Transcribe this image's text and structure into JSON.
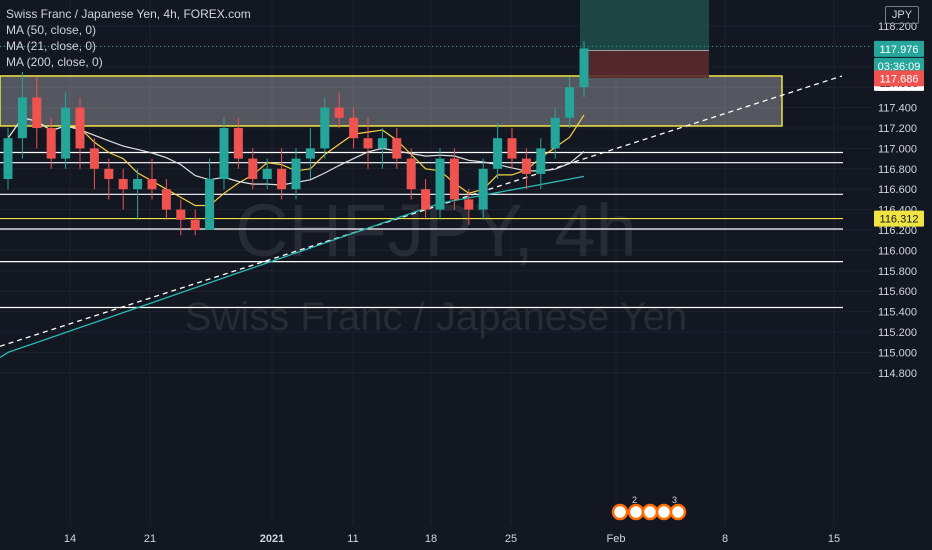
{
  "legend": {
    "title": "Swiss Franc / Japanese Yen, 4h, FOREX.com",
    "ma1": "MA (50, close, 0)",
    "ma2": "MA (21, close, 0)",
    "ma3": "MA (200, close, 0)"
  },
  "currency": "JPY",
  "watermark": {
    "symbol": "CHFJPY, 4h",
    "name": "Swiss Franc / Japanese Yen"
  },
  "colors": {
    "background": "#131722",
    "up": "#26a69a",
    "down": "#ef5350",
    "grid": "#1e222d",
    "axis_text": "#d1d4dc",
    "ma50": "#e0e0e0",
    "ma21": "#f5d142",
    "ma200": "#2bb8b0",
    "zone_border": "#f0e442",
    "horizontal_lines": "#ffffff",
    "trendline": "#ffffff",
    "last_price_bg": "#26a69a",
    "countdown_bg": "#26a69a",
    "stop_bg": "#ef5350",
    "level_bg": "#f0e442",
    "target_zone": "#1f4d4a",
    "stop_zone": "#5a2a2d"
  },
  "chart_data": {
    "type": "candlestick",
    "symbol": "CHFJPY",
    "timeframe": "4h",
    "source": "FOREX.com",
    "y_axis_ticks": [
      "118.200",
      "118.000",
      "117.800",
      "117.600",
      "117.400",
      "117.200",
      "117.000",
      "116.800",
      "116.600",
      "116.400",
      "116.200",
      "116.000",
      "115.800",
      "115.600",
      "115.400",
      "115.200",
      "115.000",
      "114.800"
    ],
    "x_axis_ticks": [
      "14",
      "21",
      "2021",
      "11",
      "18",
      "25",
      "Feb",
      "8",
      "15"
    ],
    "ylim": [
      114.6,
      118.3
    ],
    "price_labels": {
      "last_price": "117.976",
      "countdown": "03:36:09",
      "marker": "117.959",
      "stop": "117.686",
      "level": "116.312"
    },
    "horizontal_levels": [
      116.96,
      116.86,
      116.55,
      116.312,
      116.21,
      115.89,
      115.44
    ],
    "resistance_zone": {
      "low": 117.22,
      "high": 117.71
    },
    "trendline": {
      "from": {
        "date": "Dec 6",
        "price": 115.06
      },
      "to": {
        "date": "Feb 16",
        "price": 117.71
      }
    },
    "position": {
      "entry": 117.96,
      "target": 118.3,
      "stop": 117.69
    },
    "candles": [
      {
        "date": "Dec 8",
        "o": 116.7,
        "h": 117.2,
        "l": 116.6,
        "c": 117.1
      },
      {
        "date": "Dec 9",
        "o": 117.1,
        "h": 117.75,
        "l": 116.9,
        "c": 117.5
      },
      {
        "date": "Dec 10",
        "o": 117.5,
        "h": 117.7,
        "l": 117.0,
        "c": 117.2
      },
      {
        "date": "Dec 11",
        "o": 117.2,
        "h": 117.3,
        "l": 116.8,
        "c": 116.9
      },
      {
        "date": "Dec 14",
        "o": 116.9,
        "h": 117.55,
        "l": 116.8,
        "c": 117.4
      },
      {
        "date": "Dec 15",
        "o": 117.4,
        "h": 117.5,
        "l": 116.8,
        "c": 117.0
      },
      {
        "date": "Dec 16",
        "o": 117.0,
        "h": 117.1,
        "l": 116.6,
        "c": 116.8
      },
      {
        "date": "Dec 17",
        "o": 116.8,
        "h": 116.9,
        "l": 116.5,
        "c": 116.7
      },
      {
        "date": "Dec 18",
        "o": 116.7,
        "h": 116.8,
        "l": 116.4,
        "c": 116.6
      },
      {
        "date": "Dec 21",
        "o": 116.6,
        "h": 116.8,
        "l": 116.3,
        "c": 116.7
      },
      {
        "date": "Dec 22",
        "o": 116.7,
        "h": 116.9,
        "l": 116.5,
        "c": 116.6
      },
      {
        "date": "Dec 23",
        "o": 116.6,
        "h": 116.7,
        "l": 116.3,
        "c": 116.4
      },
      {
        "date": "Dec 24",
        "o": 116.4,
        "h": 116.5,
        "l": 116.15,
        "c": 116.3
      },
      {
        "date": "Dec 25",
        "o": 116.3,
        "h": 116.4,
        "l": 116.15,
        "c": 116.2
      },
      {
        "date": "Dec 28",
        "o": 116.2,
        "h": 116.9,
        "l": 116.2,
        "c": 116.7
      },
      {
        "date": "Dec 29",
        "o": 116.7,
        "h": 117.3,
        "l": 116.6,
        "c": 117.2
      },
      {
        "date": "Dec 30",
        "o": 117.2,
        "h": 117.3,
        "l": 116.8,
        "c": 116.9
      },
      {
        "date": "Dec 31",
        "o": 116.9,
        "h": 117.0,
        "l": 116.6,
        "c": 116.7
      },
      {
        "date": "Jan 1",
        "o": 116.7,
        "h": 116.9,
        "l": 116.6,
        "c": 116.8
      },
      {
        "date": "Jan 4",
        "o": 116.8,
        "h": 117.0,
        "l": 116.5,
        "c": 116.6
      },
      {
        "date": "Jan 5",
        "o": 116.6,
        "h": 117.0,
        "l": 116.5,
        "c": 116.9
      },
      {
        "date": "Jan 6",
        "o": 116.9,
        "h": 117.2,
        "l": 116.7,
        "c": 117.0
      },
      {
        "date": "Jan 7",
        "o": 117.0,
        "h": 117.5,
        "l": 116.9,
        "c": 117.4
      },
      {
        "date": "Jan 8",
        "o": 117.4,
        "h": 117.55,
        "l": 117.2,
        "c": 117.3
      },
      {
        "date": "Jan 11",
        "o": 117.3,
        "h": 117.4,
        "l": 117.0,
        "c": 117.1
      },
      {
        "date": "Jan 12",
        "o": 117.1,
        "h": 117.3,
        "l": 116.8,
        "c": 117.0
      },
      {
        "date": "Jan 13",
        "o": 117.0,
        "h": 117.2,
        "l": 116.8,
        "c": 117.1
      },
      {
        "date": "Jan 14",
        "o": 117.1,
        "h": 117.2,
        "l": 116.8,
        "c": 116.9
      },
      {
        "date": "Jan 15",
        "o": 116.9,
        "h": 117.0,
        "l": 116.5,
        "c": 116.6
      },
      {
        "date": "Jan 18",
        "o": 116.6,
        "h": 116.7,
        "l": 116.3,
        "c": 116.4
      },
      {
        "date": "Jan 19",
        "o": 116.4,
        "h": 117.0,
        "l": 116.3,
        "c": 116.9
      },
      {
        "date": "Jan 20",
        "o": 116.9,
        "h": 117.0,
        "l": 116.4,
        "c": 116.5
      },
      {
        "date": "Jan 21",
        "o": 116.5,
        "h": 116.6,
        "l": 116.25,
        "c": 116.4
      },
      {
        "date": "Jan 22",
        "o": 116.4,
        "h": 116.9,
        "l": 116.3,
        "c": 116.8
      },
      {
        "date": "Jan 25",
        "o": 116.8,
        "h": 117.25,
        "l": 116.7,
        "c": 117.1
      },
      {
        "date": "Jan 26",
        "o": 117.1,
        "h": 117.2,
        "l": 116.8,
        "c": 116.9
      },
      {
        "date": "Jan 27",
        "o": 116.9,
        "h": 117.0,
        "l": 116.6,
        "c": 116.75
      },
      {
        "date": "Jan 28",
        "o": 116.75,
        "h": 117.1,
        "l": 116.6,
        "c": 117.0
      },
      {
        "date": "Jan 29",
        "o": 117.0,
        "h": 117.4,
        "l": 116.9,
        "c": 117.3
      },
      {
        "date": "Feb 1",
        "o": 117.3,
        "h": 117.7,
        "l": 117.2,
        "c": 117.6
      },
      {
        "date": "Feb 2",
        "o": 117.6,
        "h": 118.05,
        "l": 117.5,
        "c": 117.98
      }
    ]
  },
  "event_badges": [
    "2",
    "3"
  ]
}
